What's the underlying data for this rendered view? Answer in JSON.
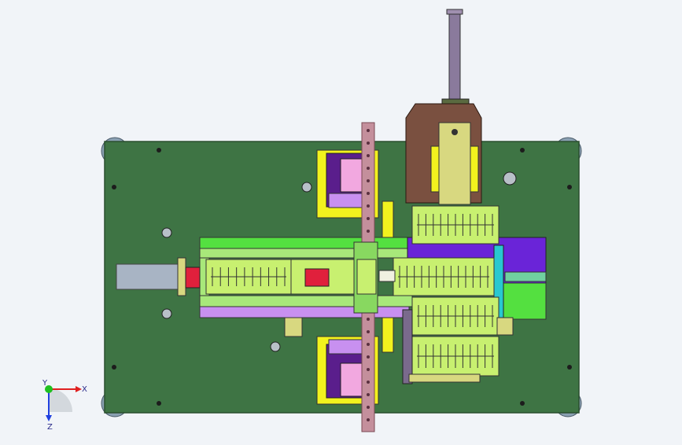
{
  "viewport": {
    "background": "#f1f4f8"
  },
  "colors": {
    "base_plate": "#3e7444",
    "plate_edge": "#2a4f2e",
    "foot": "#8aa0b2",
    "rail": "#c48f9c",
    "rail_dark": "#7a4a55",
    "yellow": "#f2f21e",
    "magenta": "#c83cd8",
    "pink": "#f2a8e0",
    "purple_dark": "#5a1e8c",
    "light_green": "#a8e87a",
    "bright_green": "#54e040",
    "lime": "#c8f070",
    "brown": "#7a5040",
    "khaki": "#d8d880",
    "blue_purple": "#6a24d8",
    "violet": "#c890f0",
    "red": "#e0203c",
    "cyan": "#28c8d0",
    "steel": "#7a6a8c",
    "cylinder": "#a8b4c4"
  },
  "axis_triad": {
    "x_label": "X",
    "y_label": "Y",
    "z_label": "Z",
    "x_color": "#e02020",
    "y_color": "#20c020",
    "z_color": "#2040e0"
  }
}
